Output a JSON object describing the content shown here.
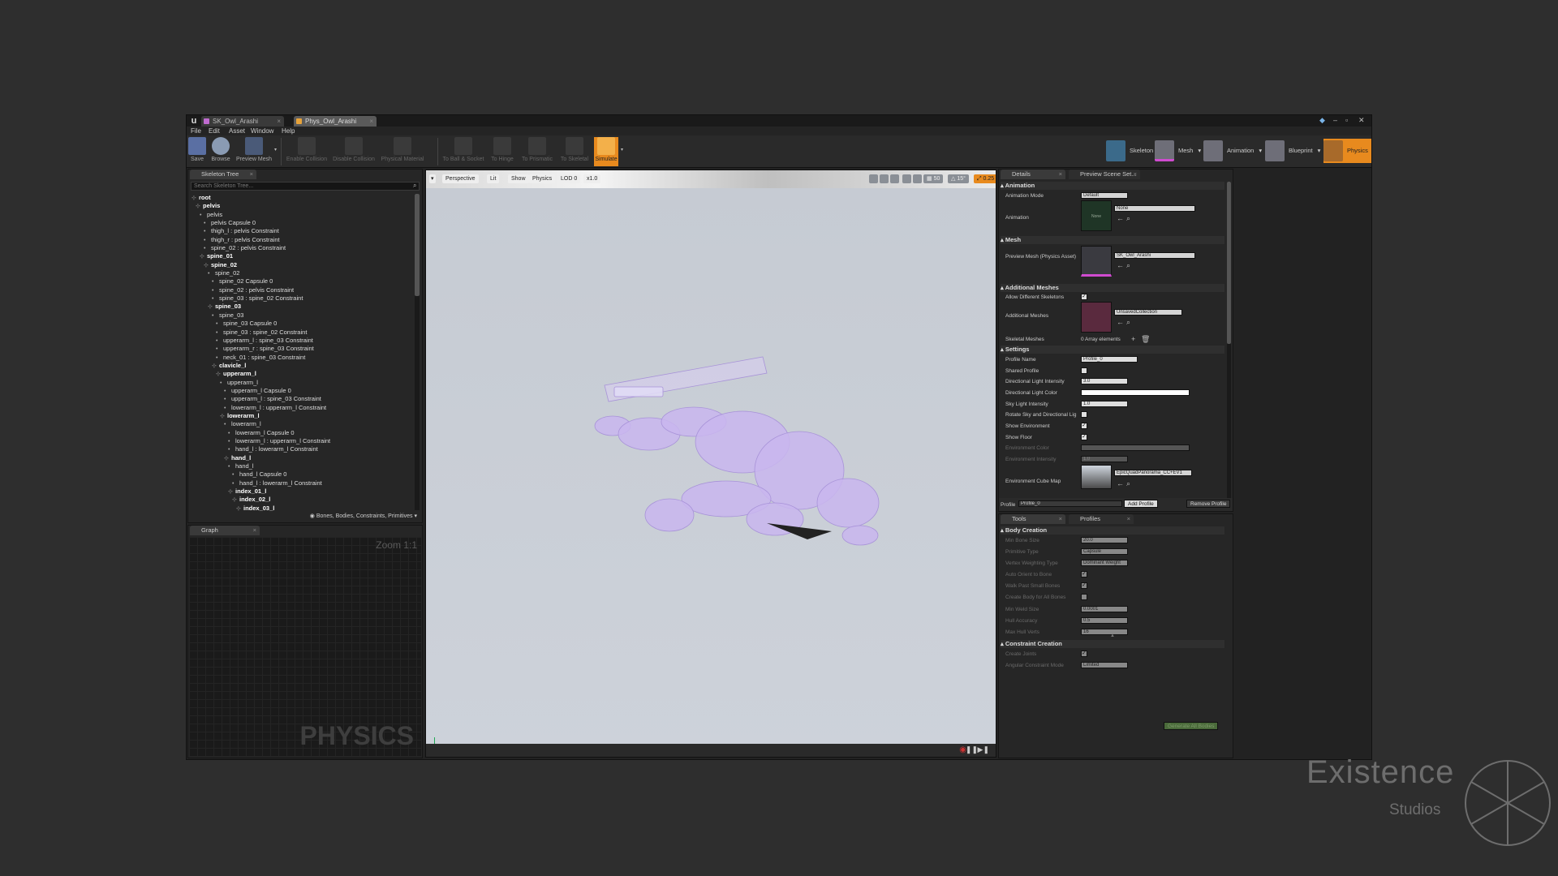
{
  "window": {
    "tabs": [
      {
        "label": "SK_Owl_Arashi"
      },
      {
        "label": "Phys_Owl_Arashi"
      }
    ],
    "menu": [
      "File",
      "Edit",
      "Asset",
      "Window",
      "Help"
    ]
  },
  "toolbar": {
    "buttons": [
      {
        "label": "Save",
        "icon": "save-icon"
      },
      {
        "label": "Browse",
        "icon": "browse-icon"
      },
      {
        "label": "Preview Mesh",
        "icon": "preview-mesh-icon"
      },
      {
        "label": "Enable Collision",
        "icon": "enable-collision-icon"
      },
      {
        "label": "Disable Collision",
        "icon": "disable-collision-icon"
      },
      {
        "label": "Physical Material",
        "icon": "physical-material-icon"
      },
      {
        "label": "To Ball & Socket",
        "icon": "ball-socket-icon"
      },
      {
        "label": "To Hinge",
        "icon": "hinge-icon"
      },
      {
        "label": "To Prismatic",
        "icon": "prismatic-icon"
      },
      {
        "label": "To Skeletal",
        "icon": "skeletal-icon"
      },
      {
        "label": "Simulate",
        "icon": "simulate-icon"
      }
    ],
    "modes": [
      {
        "label": "Skeleton"
      },
      {
        "label": "Mesh"
      },
      {
        "label": "Animation"
      },
      {
        "label": "Blueprint"
      },
      {
        "label": "Physics"
      }
    ]
  },
  "skeleton_tree": {
    "tab": "Skeleton Tree",
    "search_placeholder": "Search Skeleton Tree...",
    "items": [
      {
        "label": "root",
        "bold": true,
        "depth": 0
      },
      {
        "label": "pelvis",
        "bold": true,
        "depth": 1
      },
      {
        "label": "pelvis",
        "bold": false,
        "depth": 2
      },
      {
        "label": "pelvis Capsule 0",
        "bold": false,
        "depth": 3
      },
      {
        "label": "thigh_l : pelvis Constraint",
        "bold": false,
        "depth": 3
      },
      {
        "label": "thigh_r : pelvis Constraint",
        "bold": false,
        "depth": 3
      },
      {
        "label": "spine_02 : pelvis Constraint",
        "bold": false,
        "depth": 3
      },
      {
        "label": "spine_01",
        "bold": true,
        "depth": 2
      },
      {
        "label": "spine_02",
        "bold": true,
        "depth": 3
      },
      {
        "label": "spine_02",
        "bold": false,
        "depth": 4
      },
      {
        "label": "spine_02 Capsule 0",
        "bold": false,
        "depth": 5
      },
      {
        "label": "spine_02 : pelvis Constraint",
        "bold": false,
        "depth": 5
      },
      {
        "label": "spine_03 : spine_02 Constraint",
        "bold": false,
        "depth": 5
      },
      {
        "label": "spine_03",
        "bold": true,
        "depth": 4
      },
      {
        "label": "spine_03",
        "bold": false,
        "depth": 5
      },
      {
        "label": "spine_03 Capsule 0",
        "bold": false,
        "depth": 6
      },
      {
        "label": "spine_03 : spine_02 Constraint",
        "bold": false,
        "depth": 6
      },
      {
        "label": "upperarm_l : spine_03 Constraint",
        "bold": false,
        "depth": 6
      },
      {
        "label": "upperarm_r : spine_03 Constraint",
        "bold": false,
        "depth": 6
      },
      {
        "label": "neck_01 : spine_03 Constraint",
        "bold": false,
        "depth": 6
      },
      {
        "label": "clavicle_l",
        "bold": true,
        "depth": 5
      },
      {
        "label": "upperarm_l",
        "bold": true,
        "depth": 6
      },
      {
        "label": "upperarm_l",
        "bold": false,
        "depth": 7
      },
      {
        "label": "upperarm_l Capsule 0",
        "bold": false,
        "depth": 8
      },
      {
        "label": "upperarm_l : spine_03 Constraint",
        "bold": false,
        "depth": 8
      },
      {
        "label": "lowerarm_l : upperarm_l Constraint",
        "bold": false,
        "depth": 8
      },
      {
        "label": "lowerarm_l",
        "bold": true,
        "depth": 7
      },
      {
        "label": "lowerarm_l",
        "bold": false,
        "depth": 8
      },
      {
        "label": "lowerarm_l Capsule 0",
        "bold": false,
        "depth": 9
      },
      {
        "label": "lowerarm_l : upperarm_l Constraint",
        "bold": false,
        "depth": 9
      },
      {
        "label": "hand_l : lowerarm_l Constraint",
        "bold": false,
        "depth": 9
      },
      {
        "label": "hand_l",
        "bold": true,
        "depth": 8
      },
      {
        "label": "hand_l",
        "bold": false,
        "depth": 9
      },
      {
        "label": "hand_l Capsule 0",
        "bold": false,
        "depth": 10
      },
      {
        "label": "hand_l : lowerarm_l Constraint",
        "bold": false,
        "depth": 10
      },
      {
        "label": "index_01_l",
        "bold": true,
        "depth": 9
      },
      {
        "label": "index_02_l",
        "bold": true,
        "depth": 10
      },
      {
        "label": "index_03_l",
        "bold": true,
        "depth": 11
      }
    ],
    "filter_label": "Bones, Bodies, Constraints, Primitives"
  },
  "graph": {
    "tab": "Graph",
    "zoom": "Zoom 1:1",
    "watermark": "PHYSICS"
  },
  "viewport": {
    "buttons": [
      "Perspective",
      "Lit",
      "Show",
      "Physics",
      "LOD 0",
      "x1.0"
    ],
    "grid_snap": "50",
    "angle_snap": "15°",
    "scale_snap": "0.25",
    "camera_speed": "4"
  },
  "details": {
    "tabs": [
      "Details",
      "Preview Scene Set..."
    ],
    "animation_section": "Animation",
    "animation_mode_label": "Animation Mode",
    "animation_mode_value": "Default",
    "animation_label": "Animation",
    "animation_value": "None",
    "animation_thumb": "None",
    "mesh_section": "Mesh",
    "preview_mesh_label": "Preview Mesh (Physics Asset)",
    "preview_mesh_value": "SK_Owl_Arashi",
    "additional_section": "Additional Meshes",
    "allow_diff_label": "Allow Different Skeletons",
    "additional_meshes_label": "Additional Meshes",
    "additional_meshes_value": "UnsavedCollection",
    "skeletal_meshes_label": "Skeletal Meshes",
    "skeletal_meshes_value": "0 Array elements",
    "settings_section": "Settings",
    "profile_name_label": "Profile Name",
    "profile_name_value": "Profile_0",
    "shared_profile_label": "Shared Profile",
    "dir_light_int_label": "Directional Light Intensity",
    "dir_light_int_value": "3.0",
    "dir_light_color_label": "Directional Light Color",
    "sky_light_label": "Sky Light Intensity",
    "sky_light_value": "1.0",
    "rotate_sky_label": "Rotate Sky and Directional Lig",
    "show_env_label": "Show Environment",
    "show_floor_label": "Show Floor",
    "env_color_label": "Environment Color",
    "env_intensity_label": "Environment Intensity",
    "env_intensity_value": "1.0",
    "env_cube_label": "Environment Cube Map",
    "env_cube_value": "EpicQuadPanorama_CC+EV1",
    "profile_label": "Profile",
    "profile_value": "Profile_0",
    "add_profile": "Add Profile",
    "remove_profile": "Remove Profile"
  },
  "tools": {
    "tabs": [
      "Tools",
      "Profiles"
    ],
    "body_section": "Body Creation",
    "rows": [
      {
        "label": "Min Bone Size",
        "value": "20.0",
        "type": "field"
      },
      {
        "label": "Primitive Type",
        "value": "Capsule",
        "type": "dropdown"
      },
      {
        "label": "Vertex Weighting Type",
        "value": "Dominant Weight",
        "type": "dropdown"
      },
      {
        "label": "Auto Orient to Bone",
        "value": "",
        "type": "check"
      },
      {
        "label": "Walk Past Small Bones",
        "value": "",
        "type": "check"
      },
      {
        "label": "Create Body for All Bones",
        "value": "",
        "type": "check-empty"
      },
      {
        "label": "Min Weld Size",
        "value": "0.0001",
        "type": "field"
      },
      {
        "label": "Hull Accuracy",
        "value": "0.5",
        "type": "field"
      },
      {
        "label": "Max Hull Verts",
        "value": "16",
        "type": "field"
      }
    ],
    "constraint_section": "Constraint Creation",
    "create_joints_label": "Create Joints",
    "angular_mode_label": "Angular Constraint Mode",
    "angular_mode_value": "Limited",
    "generate_button": "Generate All Bodies"
  },
  "watermark": {
    "line1": "Existence",
    "line2": "Studios"
  }
}
